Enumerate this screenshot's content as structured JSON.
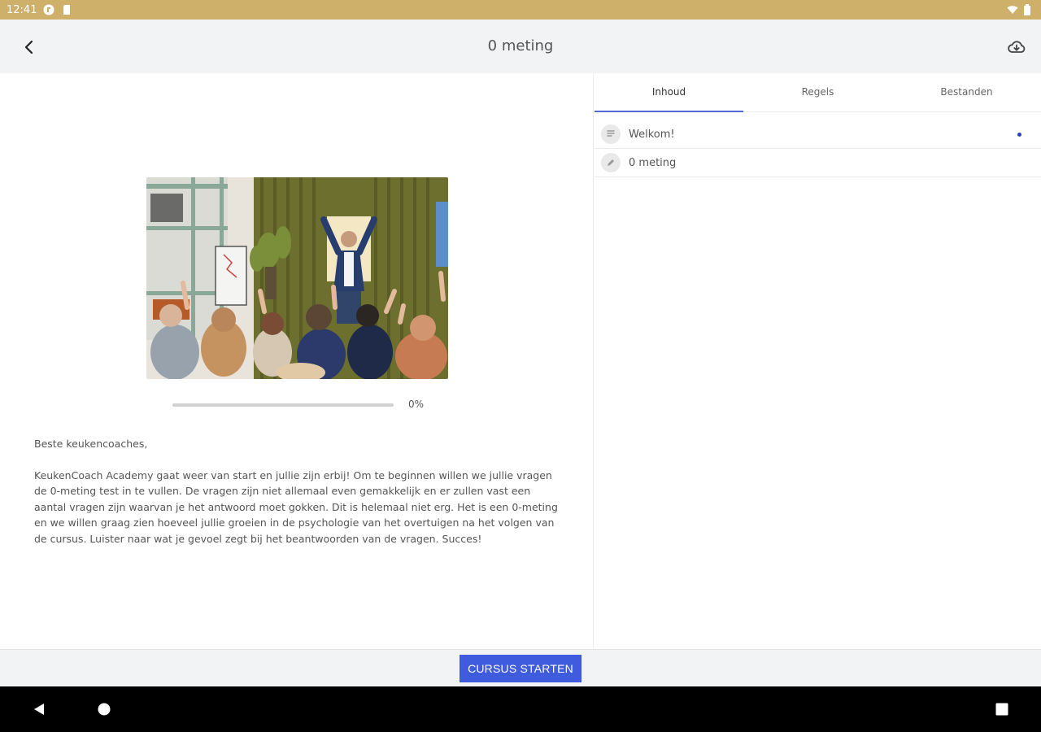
{
  "status_bar": {
    "time": "12:41"
  },
  "app_bar": {
    "title": "0 meting"
  },
  "lesson": {
    "progress_percent": 0,
    "progress_label": "0%",
    "paragraphs": [
      "Beste keukencoaches,",
      "KeukenCoach Academy gaat weer van start en jullie zijn erbij! Om te beginnen willen we jullie vragen de 0-meting test in te vullen. De vragen zijn niet allemaal even gemakkelijk en er zullen vast een aantal vragen zijn waarvan je het antwoord moet gokken. Dit is helemaal niet erg. Het is een 0-meting en we willen graag zien hoeveel jullie groeien in de psychologie van het overtuigen na het volgen van de cursus. Luister naar wat je gevoel zegt bij het beantwoorden van de vragen. Succes!"
    ]
  },
  "tabs": [
    {
      "label": "Inhoud",
      "active": true
    },
    {
      "label": "Regels",
      "active": false
    },
    {
      "label": "Bestanden",
      "active": false
    }
  ],
  "content_items": [
    {
      "label": "Welkom!",
      "icon": "document-icon",
      "unread": true
    },
    {
      "label": "0 meting",
      "icon": "pencil-icon",
      "unread": false
    }
  ],
  "action": {
    "start_label": "CURSUS STARTEN"
  },
  "colors": {
    "status_bar": "#cfb06a",
    "accent": "#3f5bde",
    "tab_indicator": "#5468d4"
  }
}
